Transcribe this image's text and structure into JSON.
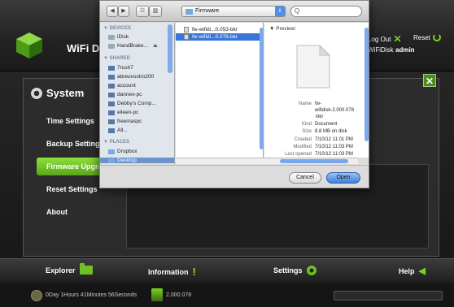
{
  "app": {
    "title": "WiFi Di",
    "logout_label": "Log Out",
    "reset_label": "Reset",
    "disk_name": "WiFiDisk",
    "user": "admin",
    "accent_color": "#7ad321"
  },
  "panel": {
    "title": "System",
    "close_glyph": "✕",
    "menu": [
      {
        "label": "Time Settings"
      },
      {
        "label": "Backup Settings"
      },
      {
        "label": "Firmware Upgrad"
      },
      {
        "label": "Reset Settings"
      },
      {
        "label": "About"
      }
    ],
    "active_index": 2
  },
  "bottom_nav": {
    "explorer": "Explorer",
    "information": "Information",
    "settings": "Settings",
    "help": "Help"
  },
  "status": {
    "uptime": "0Day 1Hours 41Minutes 56Seconds",
    "version": "2.000.078"
  },
  "dialog": {
    "nav_back": "◀",
    "nav_forward": "▶",
    "view_list": "☷",
    "view_columns": "▥",
    "location": "Firmware",
    "search_placeholder": "Q",
    "sidebar": {
      "devices_header": "▼ DEVICES",
      "devices": [
        "iDisk",
        "HandBrake..."
      ],
      "shared_header": "▼ SHARED",
      "shared": [
        "7rush7",
        "abreuvostro200",
        "account",
        "dannex-pc",
        "Debby's Comp...",
        "eileen-pc",
        "freemaspc",
        "All..."
      ],
      "places_header": "▼ PLACES",
      "places": [
        "Dropbox",
        "Desktop"
      ]
    },
    "files": [
      {
        "name": "fw-wifidi...0.053-bkr"
      },
      {
        "name": "fw-wifidi...0.078-bkr"
      }
    ],
    "preview": {
      "label": "▼ Preview:",
      "name_key": "Name",
      "name_val": "fw-",
      "name_val2": "wifidisk-2.000.078",
      "name_val3": "-bkr",
      "kind_key": "Kind",
      "kind_val": "Document",
      "size_key": "Size",
      "size_val": "8.8 MB on disk",
      "created_key": "Created",
      "created_val": "7/10/12 11:01 PM",
      "modified_key": "Modified",
      "modified_val": "7/10/12 11:03 PM",
      "opened_key": "Last opened",
      "opened_val": "7/10/12 11:03 PM"
    },
    "cancel_label": "Cancel",
    "open_label": "Open"
  }
}
